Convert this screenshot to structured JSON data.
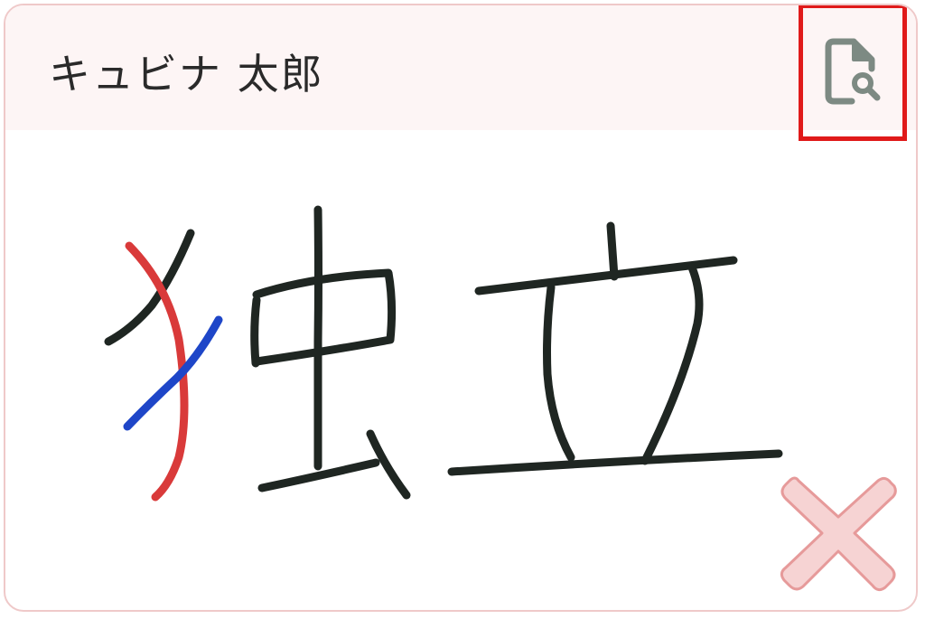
{
  "card": {
    "student_name": "キュビナ 太郎"
  },
  "icons": {
    "preview": "document-search-icon",
    "mark": "incorrect-x-mark-icon"
  },
  "colors": {
    "header_bg": "#fdf5f5",
    "card_border": "#efc9c9",
    "highlight_box": "#e01a1a",
    "ink_black": "#1f2622",
    "ink_red": "#d93a3a",
    "ink_blue": "#1e46c8",
    "x_mark_fill": "#f6d3d3",
    "x_mark_stroke": "#e69a9a",
    "icon_gray": "#7d8a83"
  }
}
